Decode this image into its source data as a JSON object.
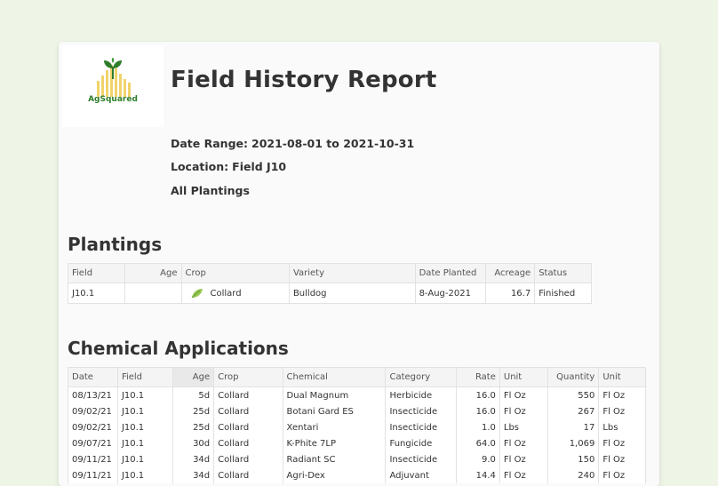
{
  "logo": {
    "text": "AgSquared"
  },
  "title": "Field History Report",
  "meta": {
    "date_range_label": "Date Range:",
    "date_range_value": "2021-08-01 to 2021-10-31",
    "location_label": "Location:",
    "location_value": "Field J10",
    "plantings_scope": "All Plantings"
  },
  "plantings": {
    "title": "Plantings",
    "columns": [
      "Field",
      "Age",
      "Crop",
      "Variety",
      "Date Planted",
      "Acreage",
      "Status"
    ],
    "rows": [
      {
        "field": "J10.1",
        "age": "",
        "crop": "Collard",
        "crop_icon": "leaf-icon",
        "variety": "Bulldog",
        "date_planted": "8-Aug-2021",
        "acreage": "16.7",
        "status": "Finished"
      }
    ]
  },
  "chemical": {
    "title": "Chemical Applications",
    "columns": [
      "Date",
      "Field",
      "Age",
      "Crop",
      "Chemical",
      "Category",
      "Rate",
      "Unit",
      "Quantity",
      "Unit"
    ],
    "rows": [
      {
        "date": "08/13/21",
        "field": "J10.1",
        "age": "5d",
        "crop": "Collard",
        "chemical": "Dual Magnum",
        "category": "Herbicide",
        "rate": "16.0",
        "unit": "Fl Oz",
        "quantity": "550",
        "qunit": "Fl Oz"
      },
      {
        "date": "09/02/21",
        "field": "J10.1",
        "age": "25d",
        "crop": "Collard",
        "chemical": "Botani Gard ES",
        "category": "Insecticide",
        "rate": "16.0",
        "unit": "Fl Oz",
        "quantity": "267",
        "qunit": "Fl Oz"
      },
      {
        "date": "09/02/21",
        "field": "J10.1",
        "age": "25d",
        "crop": "Collard",
        "chemical": "Xentari",
        "category": "Insecticide",
        "rate": "1.0",
        "unit": "Lbs",
        "quantity": "17",
        "qunit": "Lbs"
      },
      {
        "date": "09/07/21",
        "field": "J10.1",
        "age": "30d",
        "crop": "Collard",
        "chemical": "K-Phite 7LP",
        "category": "Fungicide",
        "rate": "64.0",
        "unit": "Fl Oz",
        "quantity": "1,069",
        "qunit": "Fl Oz"
      },
      {
        "date": "09/11/21",
        "field": "J10.1",
        "age": "34d",
        "crop": "Collard",
        "chemical": "Radiant SC",
        "category": "Insecticide",
        "rate": "9.0",
        "unit": "Fl Oz",
        "quantity": "150",
        "qunit": "Fl Oz"
      },
      {
        "date": "09/11/21",
        "field": "J10.1",
        "age": "34d",
        "crop": "Collard",
        "chemical": "Agri-Dex",
        "category": "Adjuvant",
        "rate": "14.4",
        "unit": "Fl Oz",
        "quantity": "240",
        "qunit": "Fl Oz"
      }
    ]
  },
  "colors": {
    "page_bg": "#eef4e6",
    "logo_green": "#2f7d2a",
    "logo_yellow": "#f1d36b"
  }
}
